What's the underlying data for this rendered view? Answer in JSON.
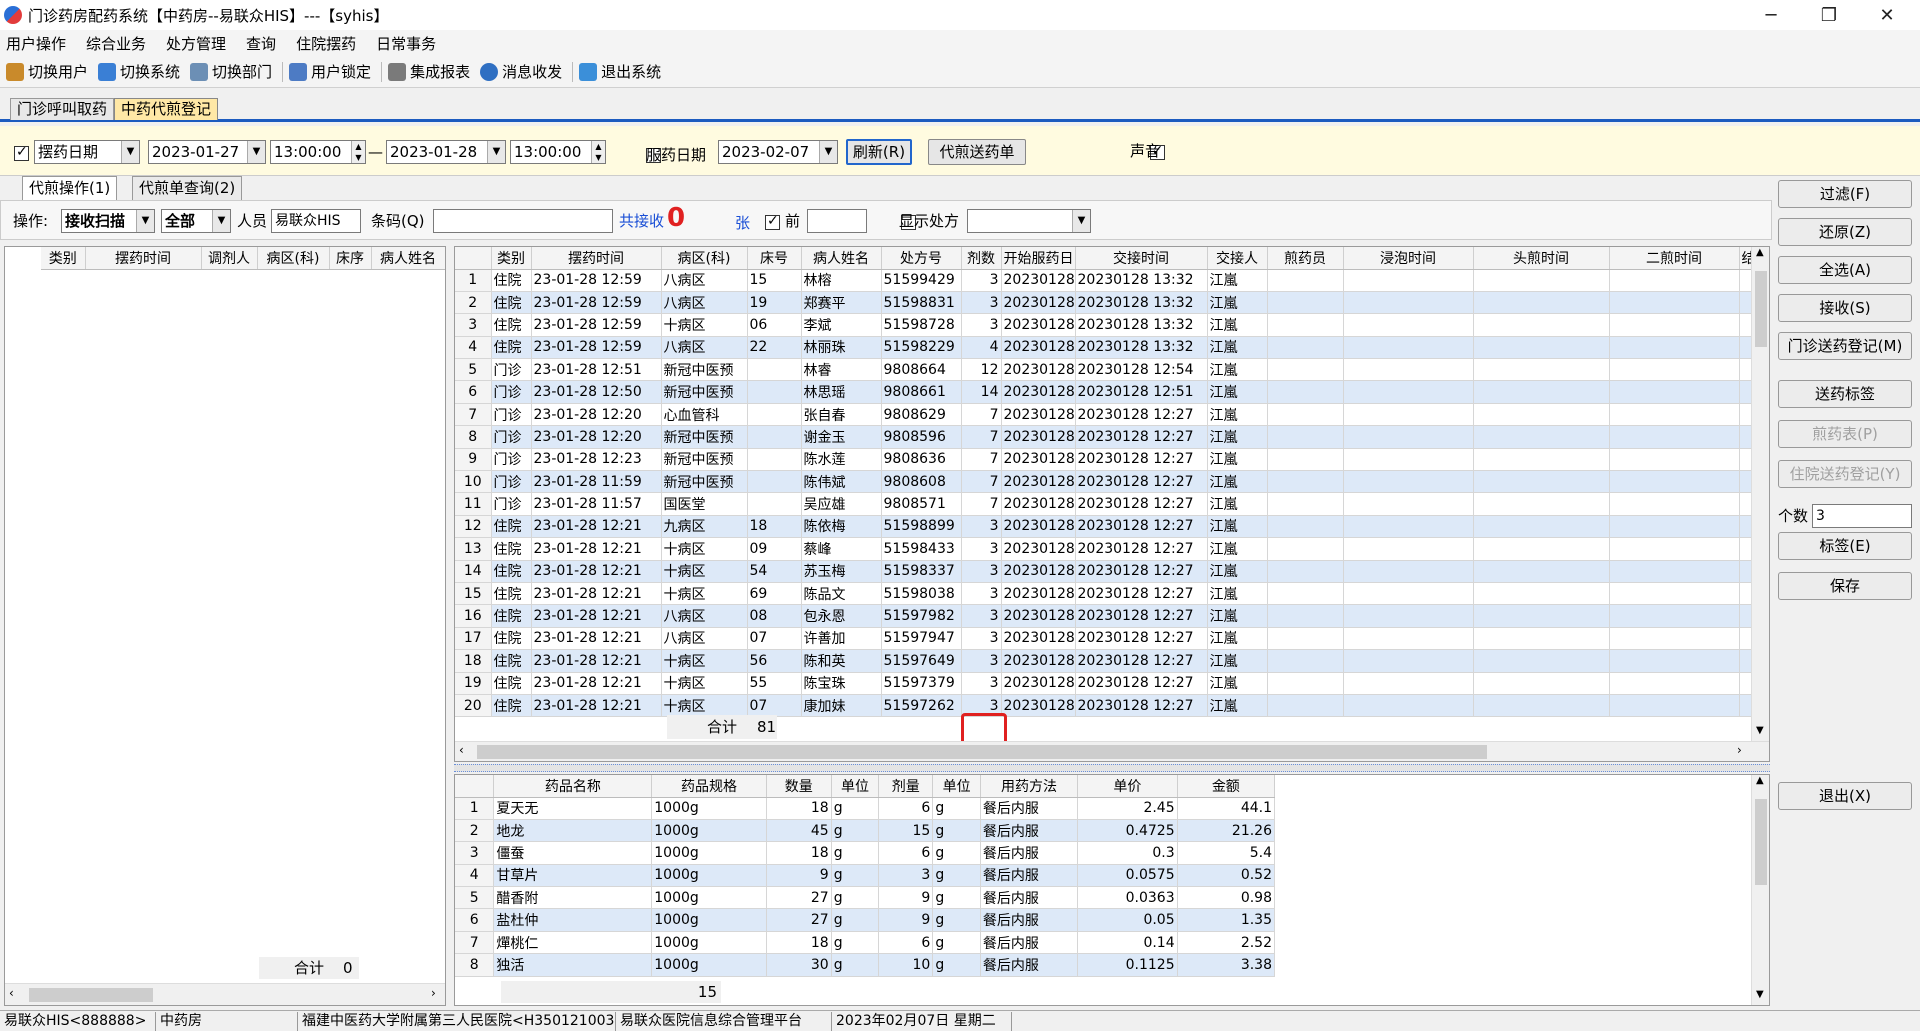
{
  "window": {
    "title": "门诊药房配药系统【中药房--易联众HIS】---【syhis】",
    "minimize": "─",
    "restore": "❐",
    "close": "✕"
  },
  "menu": [
    "用户操作",
    "综合业务",
    "处方管理",
    "查询",
    "住院摆药",
    "日常事务"
  ],
  "toolbar": [
    {
      "label": "切换用户",
      "icon": "users-icon",
      "color": "#c98a2b"
    },
    {
      "label": "切换系统",
      "icon": "switch-system-icon",
      "color": "#3a7fd5"
    },
    {
      "label": "切换部门",
      "icon": "department-icon",
      "color": "#6c8fb5"
    },
    {
      "label": "用户锁定",
      "icon": "user-lock-icon",
      "color": "#4d7bc4"
    },
    {
      "label": "集成报表",
      "icon": "report-icon",
      "color": "#7a7a7a"
    },
    {
      "label": "消息收发",
      "icon": "message-icon",
      "color": "#2f6fc2"
    },
    {
      "label": "退出系统",
      "icon": "exit-icon",
      "color": "#3b8fd9"
    }
  ],
  "module_tabs": [
    "门诊呼叫取药",
    "中药代煎登记"
  ],
  "filter": {
    "date_type": "摆药日期",
    "start_date": "2023-01-27",
    "start_time": "13:00:00",
    "separator": "—",
    "end_date": "2023-01-28",
    "end_time": "13:00:00",
    "take_date_label": "服药日期",
    "take_date": "2023-02-07",
    "refresh_label": "刷新(R)",
    "send_list_label": "代煎送药单",
    "sound_label": "声音"
  },
  "sub_tabs": [
    "代煎操作(1)",
    "代煎单查询(2)"
  ],
  "opbar": {
    "op_label": "操作:",
    "op_value": "接收扫描",
    "scope_value": "全部",
    "person_label": "人员",
    "person_value": "易联众HIS",
    "barcode_label": "条码(Q)",
    "barcode_value": "",
    "received_label": "共接收",
    "received_count": "0",
    "unit": "张",
    "before_label": "前",
    "before_value": "",
    "show_rx_label": "显示处方"
  },
  "left_grid": {
    "columns": [
      "类别",
      "摆药时间",
      "调剂人",
      "病区(科)",
      "床序",
      "病人姓名"
    ],
    "total_label": "合计",
    "total_value": "0"
  },
  "main_grid": {
    "columns": [
      "",
      "类别",
      "摆药时间",
      "病区(科)",
      "床号",
      "病人姓名",
      "处方号",
      "剂数",
      "开始服药日",
      "交接时间",
      "交接人",
      "煎药员",
      "浸泡时间",
      "头煎时间",
      "二煎时间",
      "结"
    ],
    "rows": [
      [
        "1",
        "住院",
        "23-01-28 12:59",
        "八病区",
        "15",
        "林榕",
        "51599429",
        "3",
        "20230128",
        "20230128 13:32",
        "江嵐"
      ],
      [
        "2",
        "住院",
        "23-01-28 12:59",
        "八病区",
        "19",
        "郑赛平",
        "51598831",
        "3",
        "20230128",
        "20230128 13:32",
        "江嵐"
      ],
      [
        "3",
        "住院",
        "23-01-28 12:59",
        "十病区",
        "06",
        "李斌",
        "51598728",
        "3",
        "20230128",
        "20230128 13:32",
        "江嵐"
      ],
      [
        "4",
        "住院",
        "23-01-28 12:59",
        "八病区",
        "22",
        "林丽珠",
        "51598229",
        "4",
        "20230128",
        "20230128 13:32",
        "江嵐"
      ],
      [
        "5",
        "门诊",
        "23-01-28 12:51",
        "新冠中医预",
        "",
        "林睿",
        "9808664",
        "12",
        "20230128",
        "20230128 12:54",
        "江嵐"
      ],
      [
        "6",
        "门诊",
        "23-01-28 12:50",
        "新冠中医预",
        "",
        "林思瑶",
        "9808661",
        "14",
        "20230128",
        "20230128 12:51",
        "江嵐"
      ],
      [
        "7",
        "门诊",
        "23-01-28 12:20",
        "心血管科",
        "",
        "张自春",
        "9808629",
        "7",
        "20230128",
        "20230128 12:27",
        "江嵐"
      ],
      [
        "8",
        "门诊",
        "23-01-28 12:20",
        "新冠中医预",
        "",
        "谢金玉",
        "9808596",
        "7",
        "20230128",
        "20230128 12:27",
        "江嵐"
      ],
      [
        "9",
        "门诊",
        "23-01-28 12:23",
        "新冠中医预",
        "",
        "陈水莲",
        "9808636",
        "7",
        "20230128",
        "20230128 12:27",
        "江嵐"
      ],
      [
        "10",
        "门诊",
        "23-01-28 11:59",
        "新冠中医预",
        "",
        "陈伟斌",
        "9808608",
        "7",
        "20230128",
        "20230128 12:27",
        "江嵐"
      ],
      [
        "11",
        "门诊",
        "23-01-28 11:57",
        "国医堂",
        "",
        "吴应雄",
        "9808571",
        "7",
        "20230128",
        "20230128 12:27",
        "江嵐"
      ],
      [
        "12",
        "住院",
        "23-01-28 12:21",
        "九病区",
        "18",
        "陈依梅",
        "51598899",
        "3",
        "20230128",
        "20230128 12:27",
        "江嵐"
      ],
      [
        "13",
        "住院",
        "23-01-28 12:21",
        "十病区",
        "09",
        "蔡峰",
        "51598433",
        "3",
        "20230128",
        "20230128 12:27",
        "江嵐"
      ],
      [
        "14",
        "住院",
        "23-01-28 12:21",
        "十病区",
        "54",
        "苏玉梅",
        "51598337",
        "3",
        "20230128",
        "20230128 12:27",
        "江嵐"
      ],
      [
        "15",
        "住院",
        "23-01-28 12:21",
        "十病区",
        "69",
        "陈品文",
        "51598038",
        "3",
        "20230128",
        "20230128 12:27",
        "江嵐"
      ],
      [
        "16",
        "住院",
        "23-01-28 12:21",
        "八病区",
        "08",
        "包永恩",
        "51597982",
        "3",
        "20230128",
        "20230128 12:27",
        "江嵐"
      ],
      [
        "17",
        "住院",
        "23-01-28 12:21",
        "八病区",
        "07",
        "许善加",
        "51597947",
        "3",
        "20230128",
        "20230128 12:27",
        "江嵐"
      ],
      [
        "18",
        "住院",
        "23-01-28 12:21",
        "十病区",
        "56",
        "陈和英",
        "51597649",
        "3",
        "20230128",
        "20230128 12:27",
        "江嵐"
      ],
      [
        "19",
        "住院",
        "23-01-28 12:21",
        "十病区",
        "55",
        "陈宝珠",
        "51597379",
        "3",
        "20230128",
        "20230128 12:27",
        "江嵐"
      ],
      [
        "20",
        "住院",
        "23-01-28 12:21",
        "十病区",
        "07",
        "康加妹",
        "51597262",
        "3",
        "20230128",
        "20230128 12:27",
        "江嵐"
      ]
    ],
    "total_label": "合计",
    "total_value": "81"
  },
  "drug_grid": {
    "columns": [
      "",
      "药品名称",
      "药品规格",
      "数量",
      "单位",
      "剂量",
      "单位",
      "用药方法",
      "单价",
      "金额"
    ],
    "rows": [
      [
        "1",
        "夏天无",
        "1000g",
        "18",
        "g",
        "6",
        "g",
        "餐后内服",
        "2.45",
        "44.1"
      ],
      [
        "2",
        "地龙",
        "1000g",
        "45",
        "g",
        "15",
        "g",
        "餐后内服",
        "0.4725",
        "21.26"
      ],
      [
        "3",
        "僵蚕",
        "1000g",
        "18",
        "g",
        "6",
        "g",
        "餐后内服",
        "0.3",
        "5.4"
      ],
      [
        "4",
        "甘草片",
        "1000g",
        "9",
        "g",
        "3",
        "g",
        "餐后内服",
        "0.0575",
        "0.52"
      ],
      [
        "5",
        "醋香附",
        "1000g",
        "27",
        "g",
        "9",
        "g",
        "餐后内服",
        "0.0363",
        "0.98"
      ],
      [
        "6",
        "盐杜仲",
        "1000g",
        "27",
        "g",
        "9",
        "g",
        "餐后内服",
        "0.05",
        "1.35"
      ],
      [
        "7",
        "燀桃仁",
        "1000g",
        "18",
        "g",
        "6",
        "g",
        "餐后内服",
        "0.14",
        "2.52"
      ],
      [
        "8",
        "独活",
        "1000g",
        "30",
        "g",
        "10",
        "g",
        "餐后内服",
        "0.1125",
        "3.38"
      ]
    ],
    "total_value": "15"
  },
  "right_buttons": {
    "filter": "过滤(F)",
    "restore": "还原(Z)",
    "select_all": "全选(A)",
    "receive": "接收(S)",
    "outpatient_reg": "门诊送药登记(M)",
    "delivery_label": "送药标签",
    "decoction_table": "煎药表(P)",
    "inpatient_reg": "住院送药登记(Y)",
    "count_label": "个数",
    "count_value": "3",
    "label": "标签(E)",
    "save": "保存",
    "exit": "退出(X)"
  },
  "statusbar": [
    "易联众HIS<888888>",
    "中药房",
    "福建中医药大学附属第三人民医院<H350121003",
    "易联众医院信息综合管理平台",
    "2023年02月07日 星期二"
  ],
  "highlight_color": "#e02020"
}
